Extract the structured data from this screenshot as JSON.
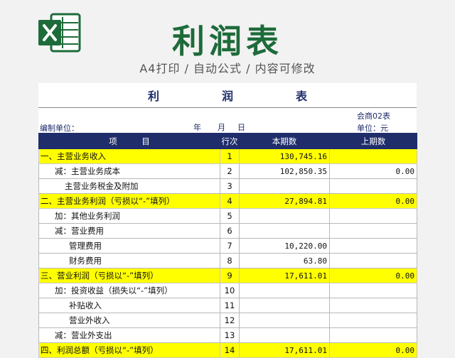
{
  "header": {
    "title": "利润表",
    "subtitle": "A4打印 / 自动公式 / 内容可修改",
    "logo_icon": "excel-logo-icon",
    "brand_color": "#1e6b3a"
  },
  "sheet": {
    "title_chars": [
      "利",
      "润",
      "表"
    ],
    "form_code": "会商02表",
    "unit_label": "编制单位：",
    "year_label": "年",
    "month_label": "月",
    "day_label": "日",
    "currency_label": "单位：元",
    "columns": [
      "项　　　目",
      "行次",
      "本期数",
      "上期数"
    ],
    "rows": [
      {
        "item": "一、主营业务收入",
        "no": "1",
        "current": "130,745.16",
        "prior": "",
        "highlight": true,
        "indent": 0
      },
      {
        "item": "减：主营业务成本",
        "no": "2",
        "current": "102,850.35",
        "prior": "0.00",
        "highlight": false,
        "indent": 1
      },
      {
        "item": "主营业务税金及附加",
        "no": "3",
        "current": "",
        "prior": "",
        "highlight": false,
        "indent": 2
      },
      {
        "item": "二、主营业务利润（亏损以“-”填列）",
        "no": "4",
        "current": "27,894.81",
        "prior": "0.00",
        "highlight": true,
        "indent": 0
      },
      {
        "item": "加：其他业务利润",
        "no": "5",
        "current": "",
        "prior": "",
        "highlight": false,
        "indent": 1
      },
      {
        "item": "减：营业费用",
        "no": "6",
        "current": "",
        "prior": "",
        "highlight": false,
        "indent": 1
      },
      {
        "item": "管理费用",
        "no": "7",
        "current": "10,220.00",
        "prior": "",
        "highlight": false,
        "indent": 3
      },
      {
        "item": "财务费用",
        "no": "8",
        "current": "63.80",
        "prior": "",
        "highlight": false,
        "indent": 3
      },
      {
        "item": "三、营业利润（亏损以“-”填列）",
        "no": "9",
        "current": "17,611.01",
        "prior": "0.00",
        "highlight": true,
        "indent": 0
      },
      {
        "item": "加：投资收益（损失以“-”填列）",
        "no": "10",
        "current": "",
        "prior": "",
        "highlight": false,
        "indent": 1
      },
      {
        "item": "补贴收入",
        "no": "11",
        "current": "",
        "prior": "",
        "highlight": false,
        "indent": 3
      },
      {
        "item": "营业外收入",
        "no": "12",
        "current": "",
        "prior": "",
        "highlight": false,
        "indent": 3
      },
      {
        "item": "减：营业外支出",
        "no": "13",
        "current": "",
        "prior": "",
        "highlight": false,
        "indent": 1
      },
      {
        "item": "四、利润总额（亏损以“-”填列）",
        "no": "14",
        "current": "17,611.01",
        "prior": "0.00",
        "highlight": true,
        "indent": 0
      }
    ]
  }
}
